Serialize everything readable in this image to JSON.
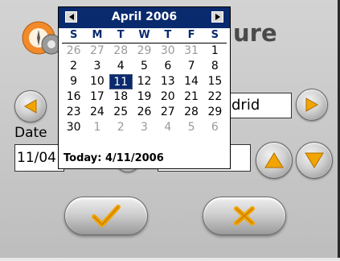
{
  "header": {
    "title_partial": "ure"
  },
  "form": {
    "city_value": "drid",
    "date_label": "Date",
    "date_value": "11/04"
  },
  "calendar": {
    "month_label": "April 2006",
    "days_of_week": [
      "S",
      "M",
      "T",
      "W",
      "T",
      "F",
      "S"
    ],
    "weeks": [
      [
        "26",
        "27",
        "28",
        "29",
        "30",
        "31",
        "1"
      ],
      [
        "2",
        "3",
        "4",
        "5",
        "6",
        "7",
        "8"
      ],
      [
        "9",
        "10",
        "11",
        "12",
        "13",
        "14",
        "15"
      ],
      [
        "16",
        "17",
        "18",
        "19",
        "20",
        "21",
        "22"
      ],
      [
        "23",
        "24",
        "25",
        "26",
        "27",
        "28",
        "29"
      ],
      [
        "30",
        "1",
        "2",
        "3",
        "4",
        "5",
        "6"
      ]
    ],
    "today_label": "Today: 4/11/2006"
  },
  "colors": {
    "calendar_header": "#0a2a6e",
    "button_yellow": "#f2a400"
  },
  "icons": {
    "logo": "clock-compass-icon",
    "prev": "triangle-left-icon",
    "next": "triangle-right-icon",
    "up": "triangle-up-icon",
    "down": "triangle-down-icon",
    "ok": "checkmark-icon",
    "cancel": "x-cross-icon"
  }
}
